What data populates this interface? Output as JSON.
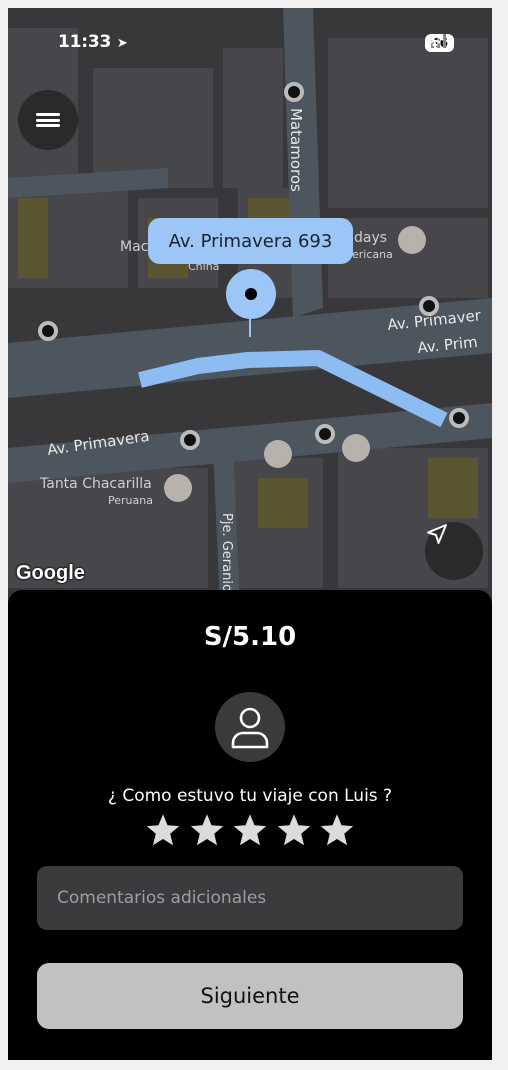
{
  "status_bar": {
    "time": "11:33",
    "battery": "46"
  },
  "map": {
    "pickup_label": "Av. Primavera 693",
    "street_labels": [
      "Matamoros",
      "Av. Primavera",
      "Av. Primavera",
      "Av. Prim",
      "Pje. Geranio",
      "Tanta Chacarilla",
      "Peruana",
      "China",
      "days",
      "ericana",
      "Mac"
    ],
    "attribution": "Google",
    "route_color": "#8dbcf2"
  },
  "sheet": {
    "fare": "S/5.10",
    "question": "¿ Como estuvo tu viaje con Luis ?",
    "rating": {
      "stars": 5,
      "selected": 0
    },
    "comment_placeholder": "Comentarios adicionales",
    "next_label": "Siguiente"
  },
  "icons": [
    "menu-icon",
    "navigation-arrow-icon",
    "user-icon",
    "star-icon",
    "restaurant-icon",
    "coffee-icon",
    "wifi-icon",
    "signal-icon",
    "location-arrow-icon"
  ]
}
